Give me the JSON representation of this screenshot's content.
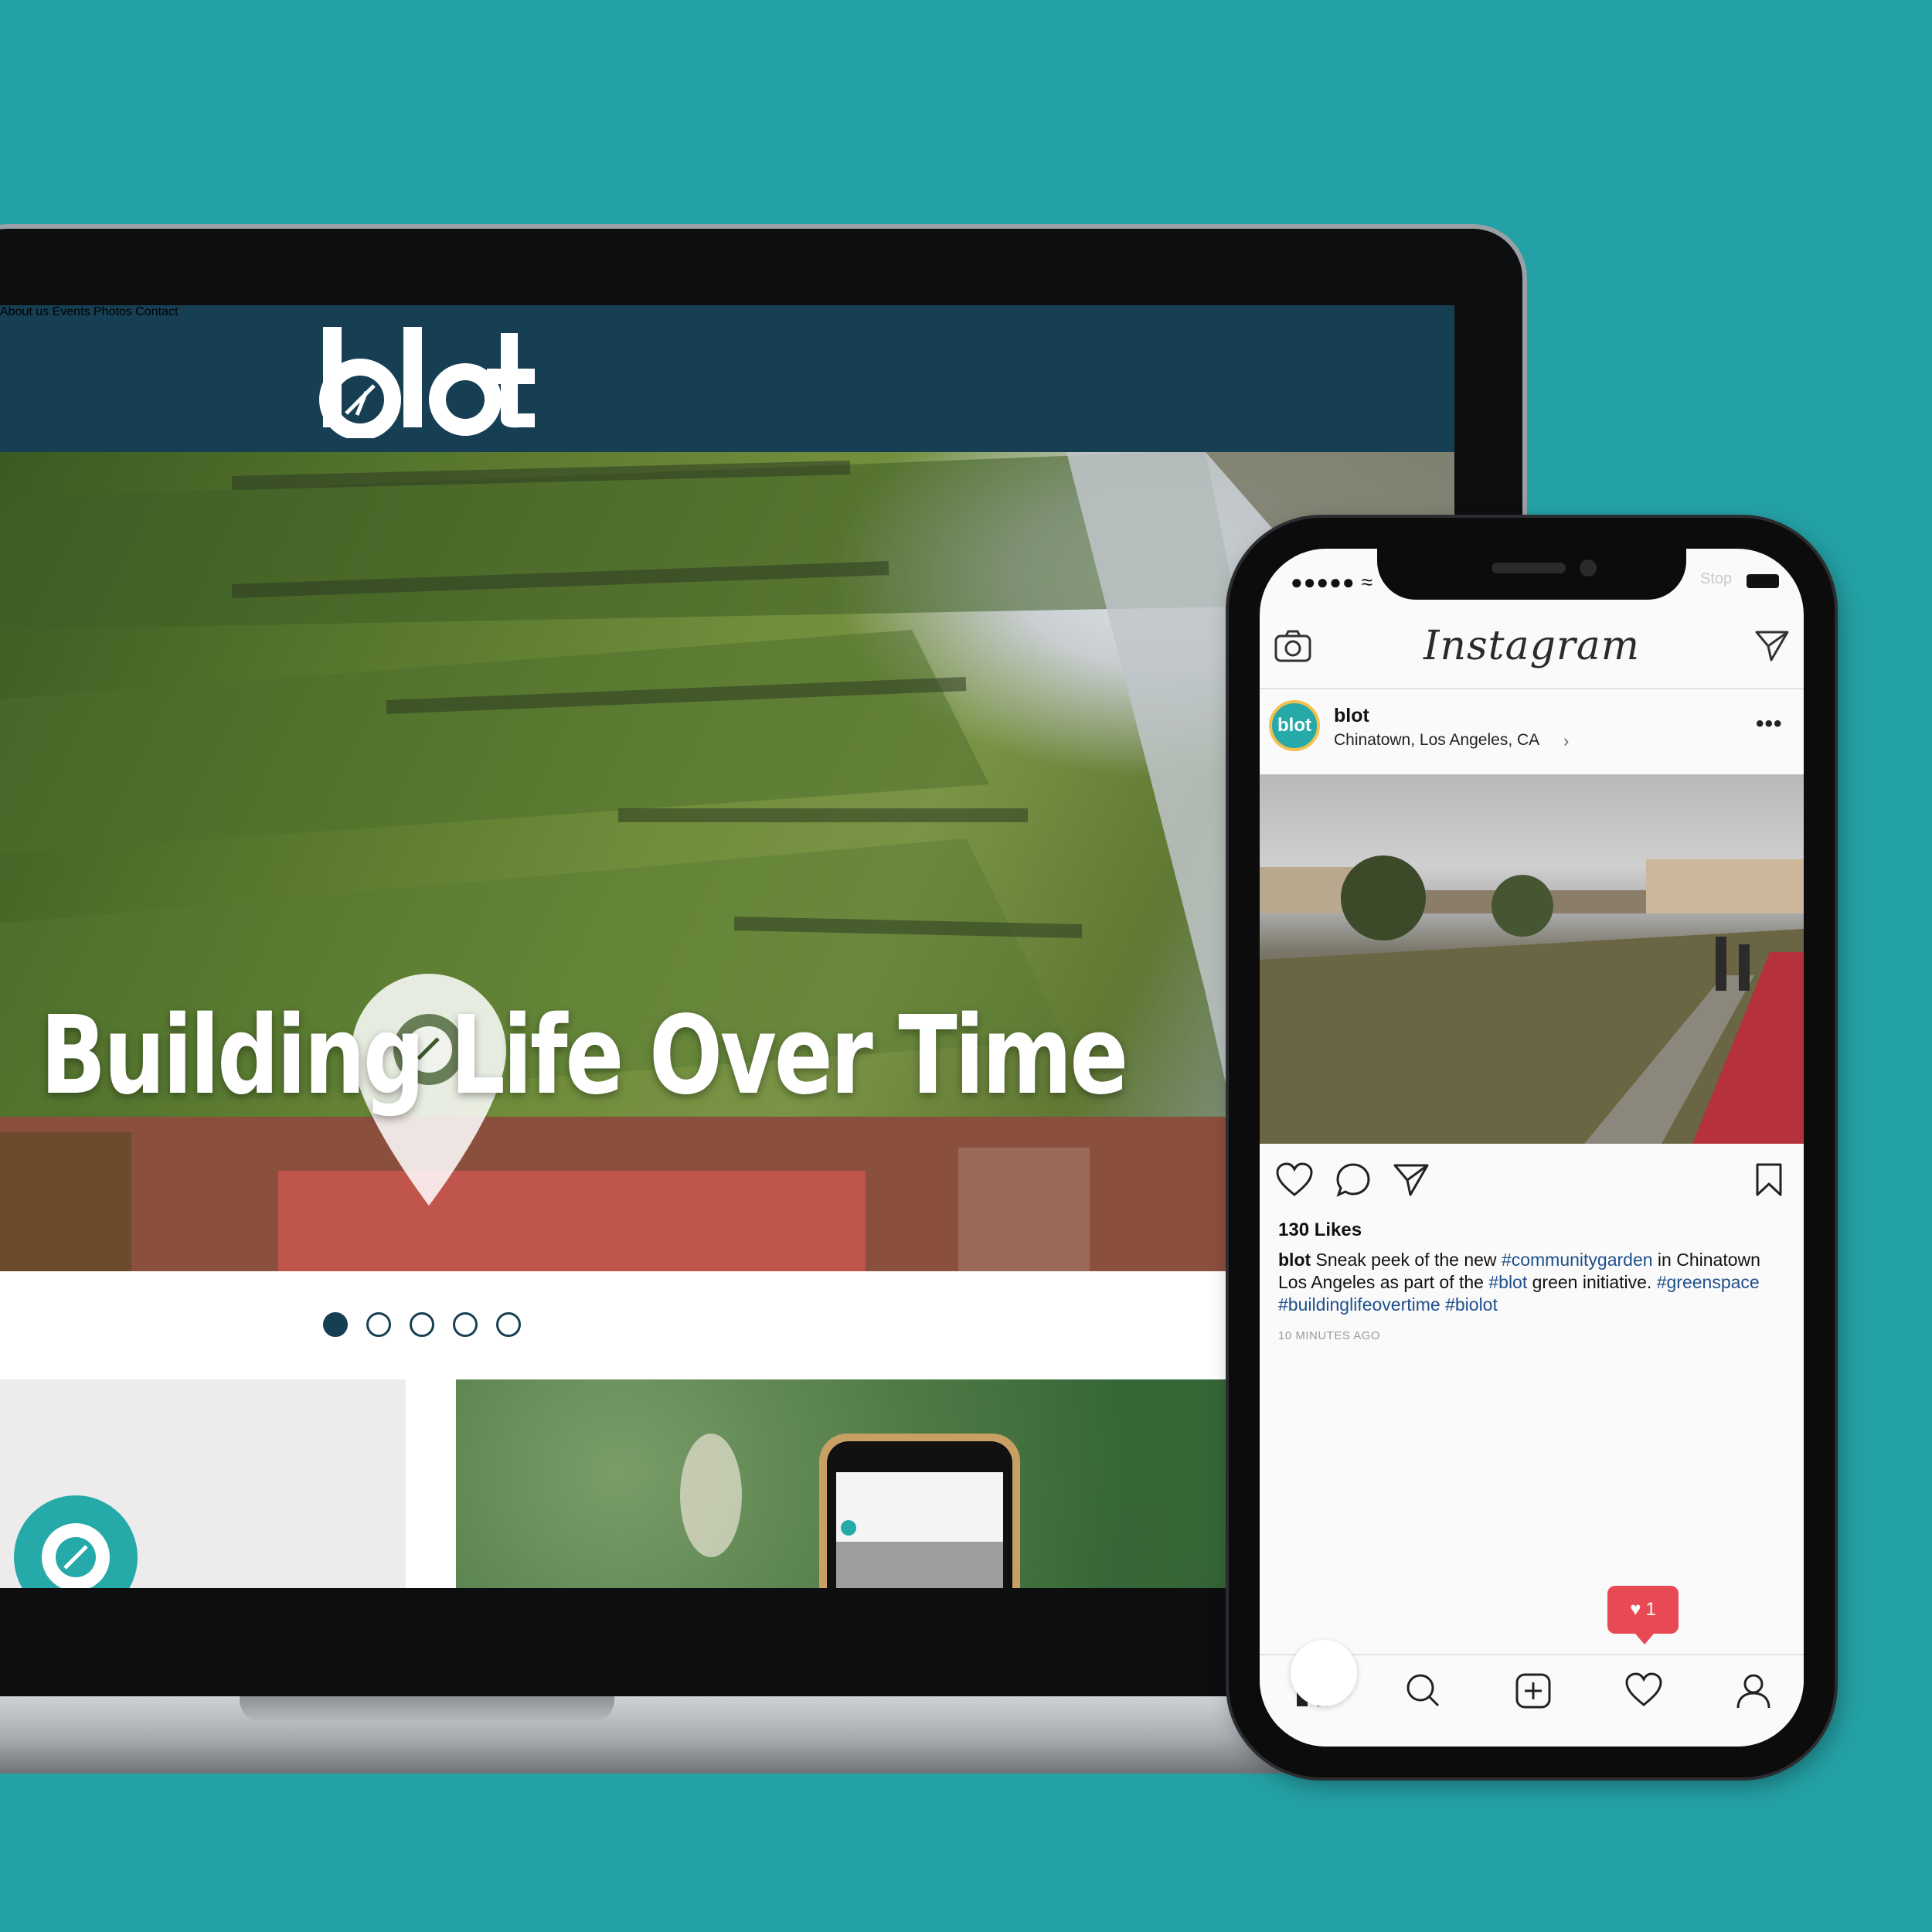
{
  "site": {
    "logo_text": "blot",
    "nav": [
      "About us",
      "Events",
      "Photos",
      "Contact"
    ],
    "hero_title": "Building Life Over Time",
    "carousel": {
      "slides": 5,
      "active_index": 0
    }
  },
  "colors": {
    "background": "#24a1a6",
    "header": "#173f54",
    "accent_teal": "#26a9a9",
    "notification_red": "#e84a55"
  },
  "phone": {
    "status": {
      "signal": "●●●●● ≈",
      "carrier_hint": "Stop"
    },
    "app_title": "Instagram",
    "post": {
      "avatar_text": "blot",
      "username": "blot",
      "location": "Chinatown, Los Angeles, CA",
      "location_arrow": "›",
      "more": "•••",
      "likes": "130 Likes",
      "caption_user": "blot",
      "caption_text_1": " Sneak peek of the new ",
      "tag_1": "#communitygarden",
      "caption_text_2": " in Chinatown Los Angeles as part of the ",
      "tag_2": "#blot",
      "caption_text_3": " green initiative. ",
      "tag_3": "#greenspace",
      "tag_4": "#buildinglifeovertime",
      "tag_5": "#biolot",
      "time": "10 MINUTES AGO"
    },
    "notification": {
      "count": "1"
    },
    "icons": {
      "top": [
        "camera-icon",
        "direct-message-icon"
      ],
      "actions": [
        "heart-icon",
        "comment-icon",
        "share-icon",
        "bookmark-icon"
      ],
      "tabs": [
        "home-icon",
        "search-icon",
        "add-icon",
        "activity-heart-icon",
        "profile-icon"
      ]
    }
  }
}
